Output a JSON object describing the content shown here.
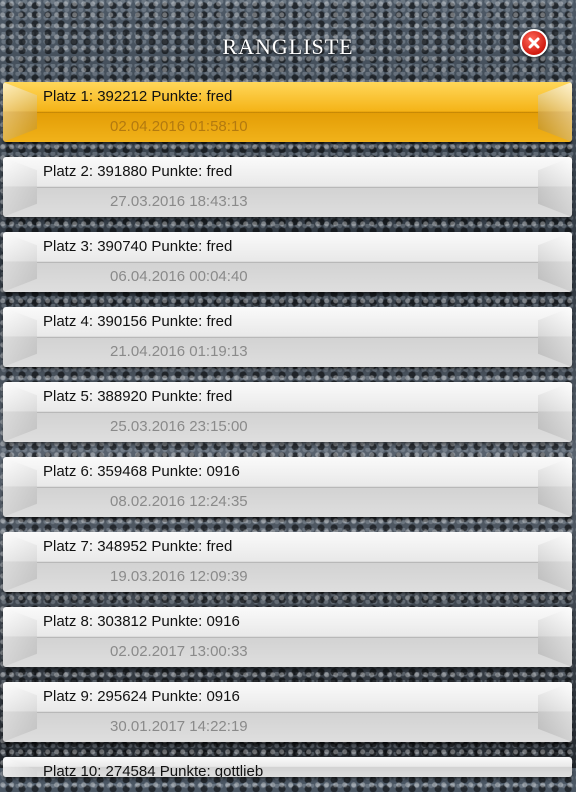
{
  "header": {
    "title": "RANGLISTE"
  },
  "entries": [
    {
      "label": "Platz 1: 392212 Punkte: fred",
      "date": "02.04.2016 01:58:10",
      "highlight": true
    },
    {
      "label": "Platz 2: 391880 Punkte: fred",
      "date": "27.03.2016 18:43:13"
    },
    {
      "label": "Platz 3: 390740 Punkte: fred",
      "date": "06.04.2016 00:04:40"
    },
    {
      "label": "Platz 4: 390156 Punkte: fred",
      "date": "21.04.2016 01:19:13"
    },
    {
      "label": "Platz 5: 388920 Punkte: fred",
      "date": "25.03.2016 23:15:00"
    },
    {
      "label": "Platz 6: 359468 Punkte: 0916",
      "date": "08.02.2016 12:24:35"
    },
    {
      "label": "Platz 7: 348952 Punkte: fred",
      "date": "19.03.2016 12:09:39"
    },
    {
      "label": "Platz 8: 303812 Punkte: 0916",
      "date": "02.02.2017 13:00:33"
    },
    {
      "label": "Platz 9: 295624 Punkte: 0916",
      "date": "30.01.2017 14:22:19"
    }
  ],
  "partial_entry": {
    "label": "Platz 10: 274584 Punkte: gottlieb"
  },
  "colors": {
    "highlight": "#f5b418",
    "row": "#e9e9e9",
    "close": "#d11a10"
  },
  "icons": {
    "close": "close-icon"
  }
}
